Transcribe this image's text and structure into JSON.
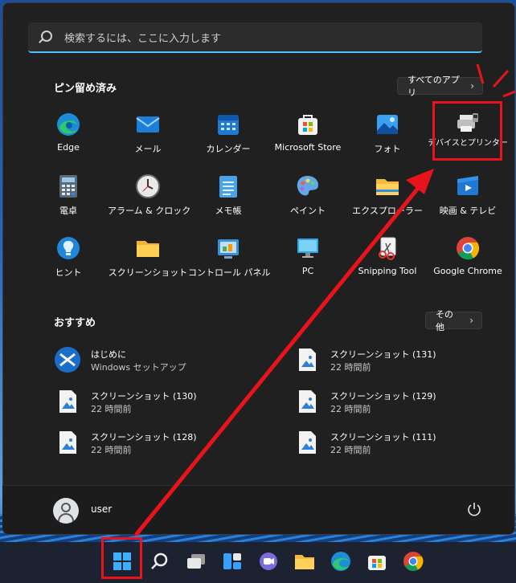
{
  "search": {
    "placeholder": "検索するには、ここに入力します"
  },
  "pinned": {
    "title": "ピン留め済み",
    "all_apps_label": "すべてのアプリ",
    "apps": [
      {
        "label": "Edge",
        "icon": "edge-icon"
      },
      {
        "label": "メール",
        "icon": "mail-icon"
      },
      {
        "label": "カレンダー",
        "icon": "calendar-icon"
      },
      {
        "label": "Microsoft Store",
        "icon": "store-icon"
      },
      {
        "label": "フォト",
        "icon": "photos-icon"
      },
      {
        "label": "デバイスとプリンター",
        "icon": "printer-icon"
      },
      {
        "label": "電卓",
        "icon": "calculator-icon"
      },
      {
        "label": "アラーム & クロック",
        "icon": "clock-icon"
      },
      {
        "label": "メモ帳",
        "icon": "notepad-icon"
      },
      {
        "label": "ペイント",
        "icon": "paint-icon"
      },
      {
        "label": "エクスプローラー",
        "icon": "folder-icon"
      },
      {
        "label": "映画 & テレビ",
        "icon": "movies-icon"
      },
      {
        "label": "ヒント",
        "icon": "tips-icon"
      },
      {
        "label": "スクリーンショット",
        "icon": "folder-icon"
      },
      {
        "label": "コントロール パネル",
        "icon": "control-panel-icon"
      },
      {
        "label": "PC",
        "icon": "pc-icon"
      },
      {
        "label": "Snipping Tool",
        "icon": "snipping-tool-icon"
      },
      {
        "label": "Google Chrome",
        "icon": "chrome-icon"
      }
    ]
  },
  "recommended": {
    "title": "おすすめ",
    "more_label": "その他",
    "items": [
      {
        "title": "はじめに",
        "subtitle": "Windows セットアップ",
        "icon": "get-started-icon"
      },
      {
        "title": "スクリーンショット (131)",
        "subtitle": "22 時間前",
        "icon": "image-file-icon"
      },
      {
        "title": "スクリーンショット (130)",
        "subtitle": "22 時間前",
        "icon": "image-file-icon"
      },
      {
        "title": "スクリーンショット (129)",
        "subtitle": "22 時間前",
        "icon": "image-file-icon"
      },
      {
        "title": "スクリーンショット (128)",
        "subtitle": "22 時間前",
        "icon": "image-file-icon"
      },
      {
        "title": "スクリーンショット (111)",
        "subtitle": "22 時間前",
        "icon": "image-file-icon"
      }
    ]
  },
  "user": {
    "name": "user"
  },
  "taskbar": {
    "items": [
      "start-icon",
      "search-icon",
      "task-view-icon",
      "widgets-icon",
      "teams-chat-icon",
      "file-explorer-icon",
      "edge-icon",
      "store-icon",
      "chrome-icon"
    ]
  },
  "colors": {
    "accent": "#4cc2ff",
    "annotation": "#e8131b",
    "panel": "#202020"
  }
}
